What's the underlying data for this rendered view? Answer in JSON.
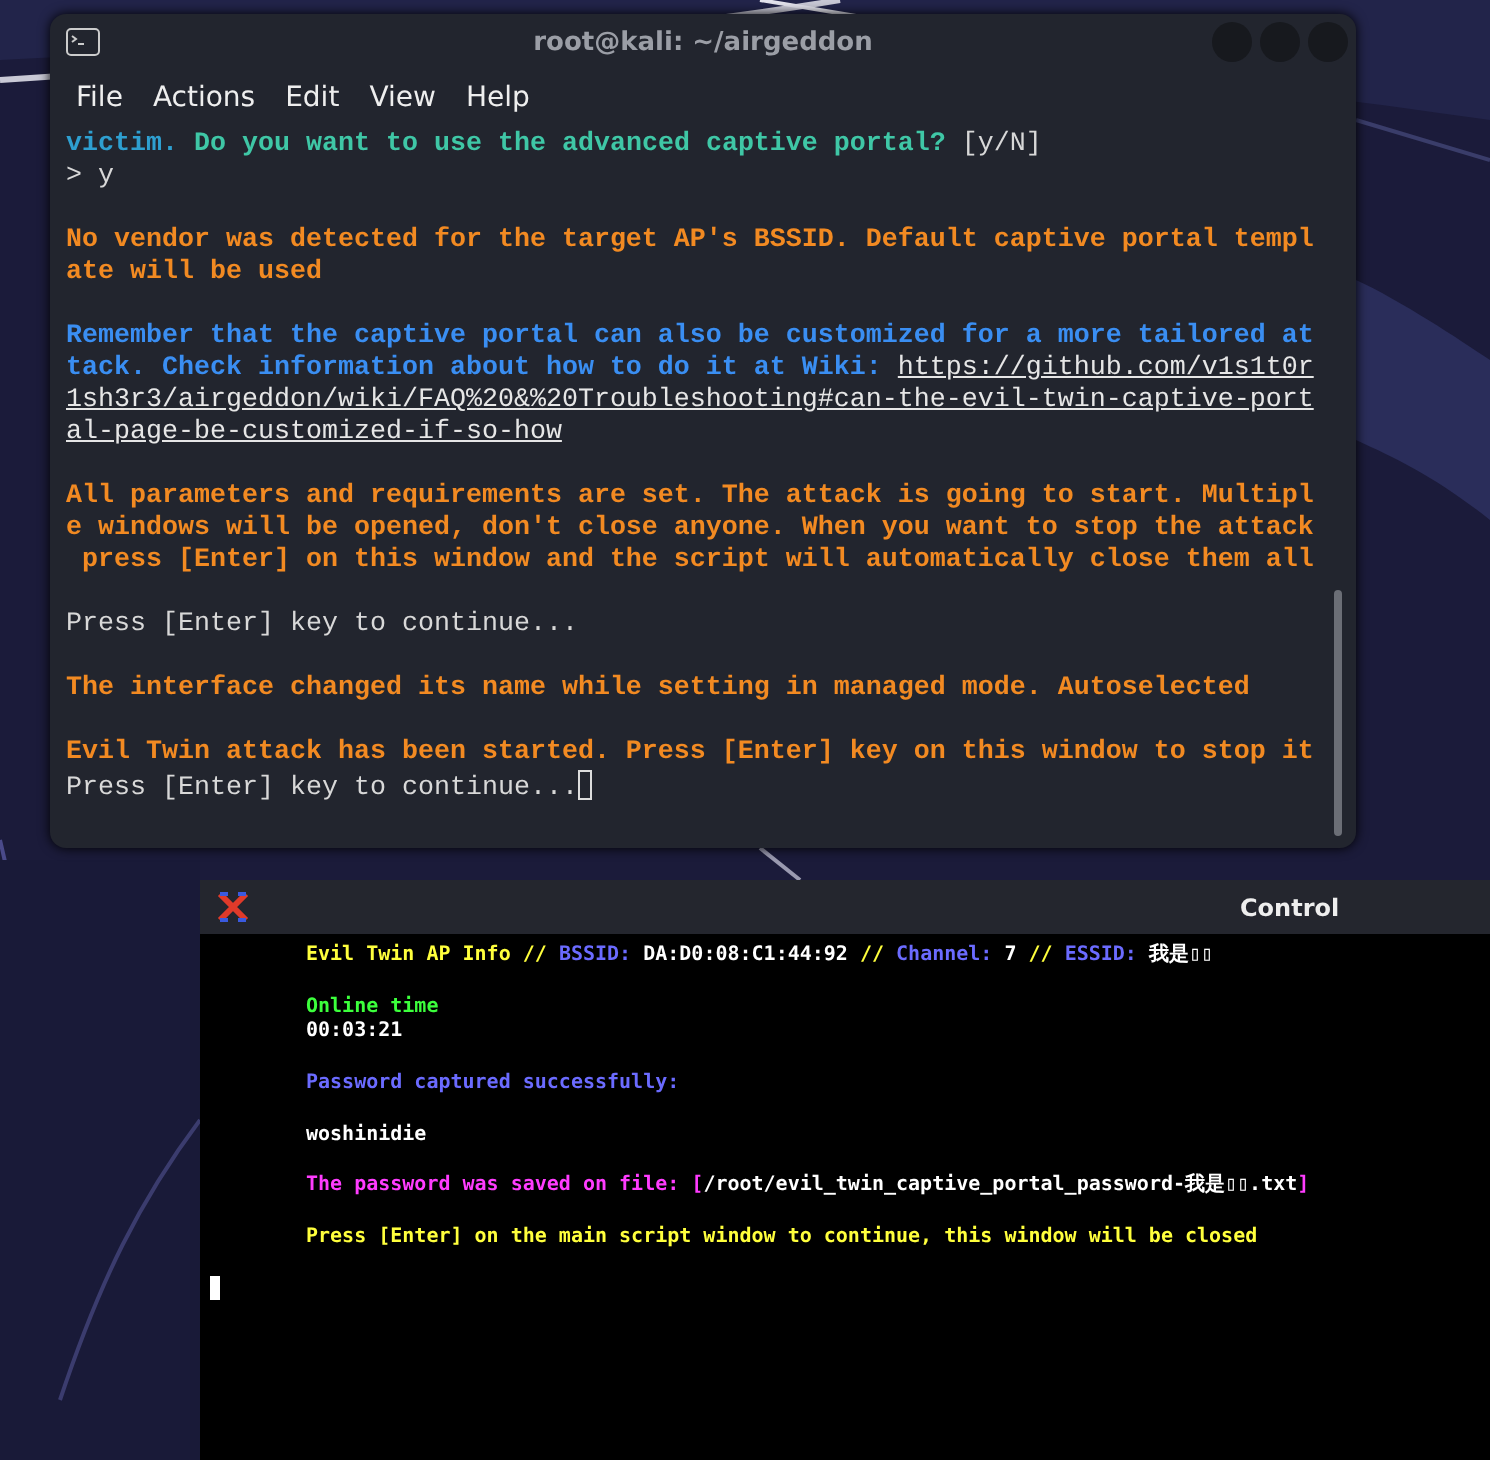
{
  "main_terminal": {
    "title": "root@kali: ~/airgeddon",
    "menu": [
      "File",
      "Actions",
      "Edit",
      "View",
      "Help"
    ],
    "paragraphs": [
      {
        "lines": [
          {
            "segments": [
              {
                "text": "victim. ",
                "color": "#2e9fd0",
                "bold": true
              },
              {
                "text": "Do you want to use the advanced captive portal? ",
                "color": "#3fc7a6",
                "bold": true
              },
              {
                "text": "[y/N]",
                "color": "#d8d8d8",
                "bold": false
              }
            ]
          },
          {
            "segments": [
              {
                "text": "> y",
                "color": "#d8d8d8",
                "bold": false
              }
            ]
          }
        ]
      },
      {
        "lines": [
          {
            "segments": [
              {
                "text": "No vendor was detected for the target AP's BSSID. Default captive portal templ",
                "color": "#f28a22",
                "bold": true
              }
            ]
          },
          {
            "segments": [
              {
                "text": "ate will be used",
                "color": "#f28a22",
                "bold": true
              }
            ]
          }
        ]
      },
      {
        "lines": [
          {
            "segments": [
              {
                "text": "Remember that the captive portal can also be customized for a more tailored at",
                "color": "#3a8ef2",
                "bold": true
              }
            ]
          },
          {
            "segments": [
              {
                "text": "tack. Check information about how to do it at Wiki: ",
                "color": "#3a8ef2",
                "bold": true
              },
              {
                "text": "https://github.com/v1s1t0r",
                "color": "#e6e6e6",
                "bold": false,
                "kind": "link"
              }
            ]
          },
          {
            "segments": [
              {
                "text": "1sh3r3/airgeddon/wiki/FAQ%20&%20Troubleshooting#can-the-evil-twin-captive-port",
                "color": "#e6e6e6",
                "bold": false,
                "kind": "link"
              }
            ]
          },
          {
            "segments": [
              {
                "text": "al-page-be-customized-if-so-how",
                "color": "#e6e6e6",
                "bold": false,
                "kind": "link"
              }
            ]
          }
        ]
      },
      {
        "lines": [
          {
            "segments": [
              {
                "text": "All parameters and requirements are set. The attack is going to start. Multipl",
                "color": "#f28a22",
                "bold": true
              }
            ]
          },
          {
            "segments": [
              {
                "text": "e windows will be opened, don't close anyone. When you want to stop the attack",
                "color": "#f28a22",
                "bold": true
              }
            ]
          },
          {
            "segments": [
              {
                "text": " press [Enter] on this window and the script will automatically close them all",
                "color": "#f28a22",
                "bold": true
              }
            ]
          }
        ]
      },
      {
        "lines": [
          {
            "segments": [
              {
                "text": "Press [Enter] key to continue...",
                "color": "#d8d8d8",
                "bold": false
              }
            ]
          }
        ]
      },
      {
        "lines": [
          {
            "segments": [
              {
                "text": "The interface changed its name while setting in managed mode. Autoselected",
                "color": "#f28a22",
                "bold": true
              }
            ]
          }
        ]
      },
      {
        "lines": [
          {
            "segments": [
              {
                "text": "Evil Twin attack has been started. Press [Enter] key on this window to stop it",
                "color": "#f28a22",
                "bold": true
              }
            ]
          },
          {
            "segments": [
              {
                "text": "Press [Enter] key to continue...",
                "color": "#d8d8d8",
                "bold": false
              }
            ],
            "cursor": true
          }
        ]
      }
    ]
  },
  "control_terminal": {
    "title": "Control",
    "paragraphs": [
      {
        "lines": [
          {
            "segments": [
              {
                "text": "Evil Twin AP Info // ",
                "color": "#ffff3c"
              },
              {
                "text": "BSSID: ",
                "color": "#6b6bff"
              },
              {
                "text": "DA:D0:08:C1:44:92 ",
                "color": "#ffffff"
              },
              {
                "text": "// ",
                "color": "#ffff3c"
              },
              {
                "text": "Channel: ",
                "color": "#6b6bff"
              },
              {
                "text": "7 ",
                "color": "#ffffff"
              },
              {
                "text": "// ",
                "color": "#ffff3c"
              },
              {
                "text": "ESSID: ",
                "color": "#6b6bff"
              },
              {
                "text": "我是▯▯",
                "color": "#ffffff"
              }
            ]
          }
        ]
      },
      {
        "lines": [
          {
            "segments": [
              {
                "text": "Online time",
                "color": "#3cff3c"
              }
            ]
          },
          {
            "segments": [
              {
                "text": "00:03:21",
                "color": "#ffffff"
              }
            ]
          }
        ]
      },
      {
        "lines": [
          {
            "segments": [
              {
                "text": "Password captured successfully:",
                "color": "#6b6bff"
              }
            ]
          }
        ]
      },
      {
        "lines": [
          {
            "segments": [
              {
                "text": "woshinidie",
                "color": "#ffffff"
              }
            ]
          }
        ]
      },
      {
        "lines": [
          {
            "segments": [
              {
                "text": "The password was saved on file: ",
                "color": "#ff3cff"
              },
              {
                "text": "[",
                "color": "#ff3cff"
              },
              {
                "text": "/root/evil_twin_captive_portal_password-我是▯▯.txt",
                "color": "#ffffff"
              },
              {
                "text": "]",
                "color": "#ff3cff"
              }
            ]
          }
        ]
      },
      {
        "lines": [
          {
            "segments": [
              {
                "text": "Press [Enter] on the main script window to continue, this window will be closed",
                "color": "#ffff3c"
              }
            ]
          }
        ]
      },
      {
        "lines": [
          {
            "cursor": true
          }
        ]
      }
    ]
  }
}
